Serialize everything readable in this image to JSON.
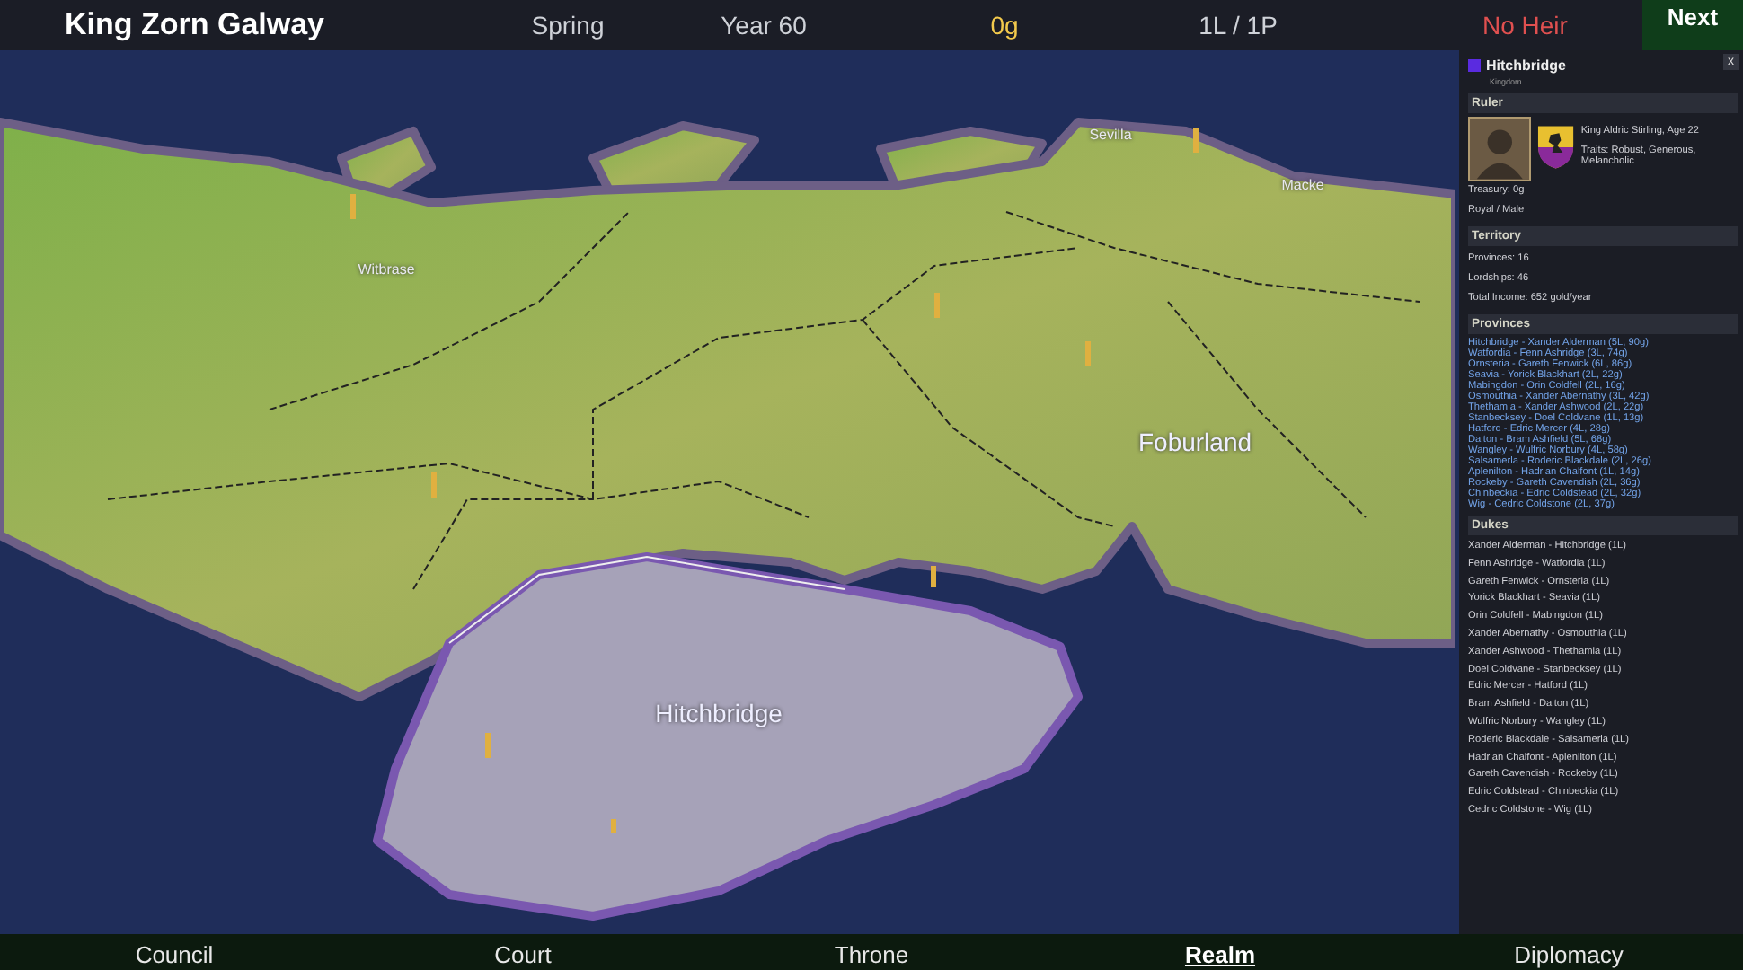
{
  "top_bar": {
    "ruler": "King Zorn Galway",
    "season": "Spring",
    "year": "Year 60",
    "gold": "0g",
    "holdings": "1L / 1P",
    "heir_status": "No Heir",
    "next_button": "Next"
  },
  "map": {
    "labels": [
      {
        "text": "Witbrase",
        "kind": "town"
      },
      {
        "text": "Sevilla",
        "kind": "town"
      },
      {
        "text": "Macke",
        "kind": "town"
      },
      {
        "text": "Foburland",
        "kind": "region"
      },
      {
        "text": "Hitchbridge",
        "kind": "region"
      }
    ]
  },
  "panel": {
    "title": "Hitchbridge",
    "color": "#5a2be0",
    "subtitle": "Kingdom",
    "close": "x",
    "ruler": {
      "header": "Ruler",
      "name": "King Aldric Stirling, Age 22",
      "traits": "Traits: Robust, Generous, Melancholic",
      "treasury": "Treasury: 0g",
      "status": "Royal / Male"
    },
    "territory": {
      "header": "Territory",
      "lines": [
        "Provinces: 16",
        "Lordships: 46",
        "Total Income: 652 gold/year"
      ]
    },
    "provinces": {
      "header": "Provinces",
      "items": [
        "Hitchbridge - Xander Alderman (5L, 90g)",
        "Watfordia - Fenn Ashridge (3L, 74g)",
        "Ornsteria - Gareth Fenwick (6L, 86g)",
        "Seavia - Yorick Blackhart (2L, 22g)",
        "Mabingdon - Orin Coldfell (2L, 16g)",
        "Osmouthia - Xander Abernathy (3L, 42g)",
        "Thethamia - Xander Ashwood (2L, 22g)",
        "Stanbecksey - Doel Coldvane (1L, 13g)",
        "Hatford - Edric Mercer (4L, 28g)",
        "Dalton - Bram Ashfield (5L, 68g)",
        "Wangley - Wulfric Norbury (4L, 58g)",
        "Salsamerla - Roderic Blackdale (2L, 26g)",
        "Aplenilton - Hadrian Chalfont (1L, 14g)",
        "Rockeby - Gareth Cavendish (2L, 36g)",
        "Chinbeckia - Edric Coldstead (2L, 32g)",
        "Wig - Cedric Coldstone (2L, 37g)"
      ]
    },
    "dukes": {
      "header": "Dukes",
      "items": [
        "Xander Alderman - Hitchbridge (1L)",
        "Fenn Ashridge - Watfordia (1L)",
        "Gareth Fenwick - Ornsteria (1L)",
        "Yorick Blackhart - Seavia (1L)",
        "Orin Coldfell - Mabingdon (1L)",
        "Xander Abernathy - Osmouthia (1L)",
        "Xander Ashwood - Thethamia (1L)",
        "Doel Coldvane - Stanbecksey (1L)",
        "Edric Mercer - Hatford (1L)",
        "Bram Ashfield - Dalton (1L)",
        "Wulfric Norbury - Wangley (1L)",
        "Roderic Blackdale - Salsamerla (1L)",
        "Hadrian Chalfont - Aplenilton (1L)",
        "Gareth Cavendish - Rockeby (1L)",
        "Edric Coldstead - Chinbeckia (1L)",
        "Cedric Coldstone - Wig (1L)"
      ]
    }
  },
  "bottom_tabs": [
    {
      "label": "Council",
      "selected": false
    },
    {
      "label": "Court",
      "selected": false
    },
    {
      "label": "Throne",
      "selected": false
    },
    {
      "label": "Realm",
      "selected": true
    },
    {
      "label": "Diplomacy",
      "selected": false
    }
  ]
}
